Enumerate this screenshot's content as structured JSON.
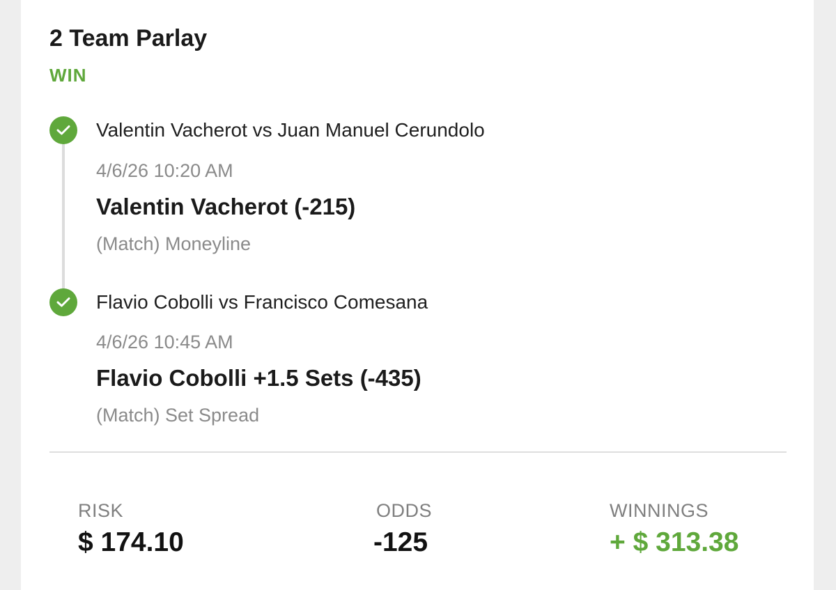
{
  "bet": {
    "title": "2 Team Parlay",
    "status": "WIN",
    "status_color": "#5fa83b"
  },
  "legs": [
    {
      "matchup": "Valentin Vacherot vs Juan Manuel Cerundolo",
      "datetime": "4/6/26 10:20 AM",
      "pick": "Valentin Vacherot (-215)",
      "market": "(Match) Moneyline",
      "result_icon": "check-icon"
    },
    {
      "matchup": "Flavio Cobolli vs Francisco Comesana",
      "datetime": "4/6/26 10:45 AM",
      "pick": "Flavio Cobolli +1.5 Sets (-435)",
      "market": "(Match) Set Spread",
      "result_icon": "check-icon"
    }
  ],
  "summary": {
    "risk_label": "RISK",
    "risk_value": "$ 174.10",
    "odds_label": "ODDS",
    "odds_value": "-125",
    "winnings_label": "WINNINGS",
    "winnings_value": "+ $ 313.38"
  }
}
